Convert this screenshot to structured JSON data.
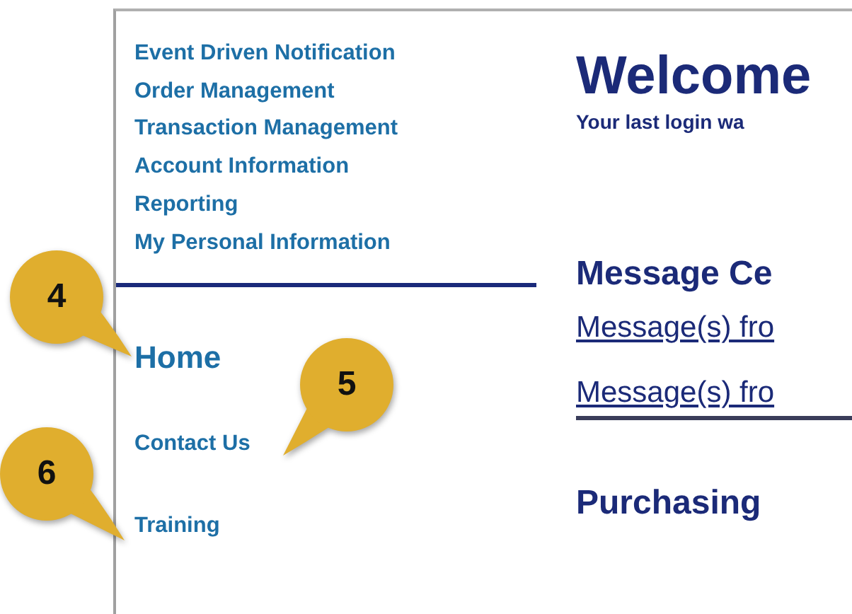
{
  "sidebar": {
    "items": [
      {
        "label": "Event Driven Notification"
      },
      {
        "label": "Order Management"
      },
      {
        "label": "Transaction Management"
      },
      {
        "label": "Account Information"
      },
      {
        "label": "Reporting"
      },
      {
        "label": "My Personal Information"
      }
    ],
    "links": [
      {
        "label": "Home",
        "kind": "large"
      },
      {
        "label": "Contact Us",
        "kind": "small"
      },
      {
        "label": "Training",
        "kind": "small"
      }
    ]
  },
  "main": {
    "title": "Welcome",
    "subtitle": "Your last login wa",
    "message_center": {
      "heading": "Message Ce",
      "links": [
        "Message(s) fro",
        "Message(s) fro"
      ]
    },
    "purchasing": {
      "heading": "Purchasing"
    }
  },
  "callouts": [
    "4",
    "5",
    "6"
  ]
}
